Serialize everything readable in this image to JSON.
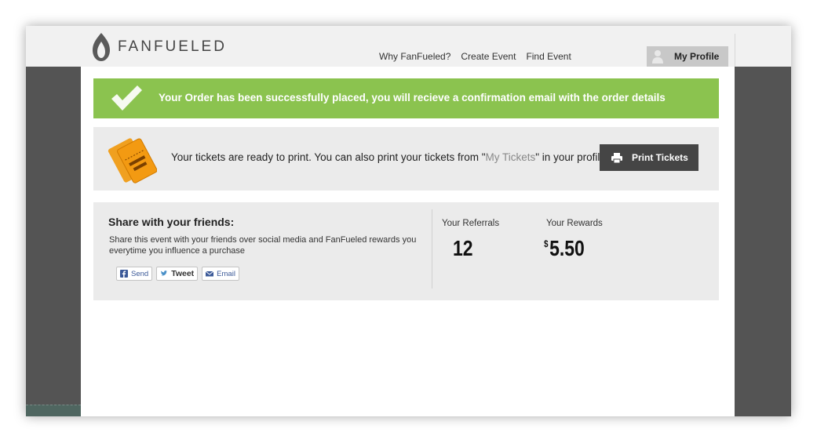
{
  "brand": {
    "name": "FANFUELED"
  },
  "nav": [
    {
      "label": "Why FanFueled?"
    },
    {
      "label": "Create Event"
    },
    {
      "label": "Find Event"
    }
  ],
  "profile": {
    "label": "My Profile"
  },
  "success": {
    "message": "Your Order has been successfully placed, you will recieve a confirmation email with the order details"
  },
  "tickets": {
    "text_before": "Your tickets are ready to print. You can also print your tickets from \"",
    "link": "My Tickets",
    "text_after": "\" in your profile.",
    "print_label": "Print Tickets"
  },
  "share": {
    "title": "Share with your friends:",
    "description": "Share this event with your friends over social media and FanFueled rewards you everytime you influence a purchase",
    "buttons": {
      "send": "Send",
      "tweet": "Tweet",
      "email": "Email"
    }
  },
  "stats": {
    "referrals_label": "Your Referrals",
    "referrals_value": "12",
    "rewards_label": "Your Rewards",
    "rewards_currency": "$",
    "rewards_value": "5.50"
  },
  "colors": {
    "success_green": "#8bc34f",
    "panel_gray": "#ebebeb",
    "dark_button": "#454545",
    "sidebar": "#545454"
  },
  "icons": [
    "flame-logo-icon",
    "user-icon",
    "checkmark-icon",
    "ticket-icon",
    "printer-icon",
    "facebook-icon",
    "twitter-icon",
    "email-icon"
  ]
}
